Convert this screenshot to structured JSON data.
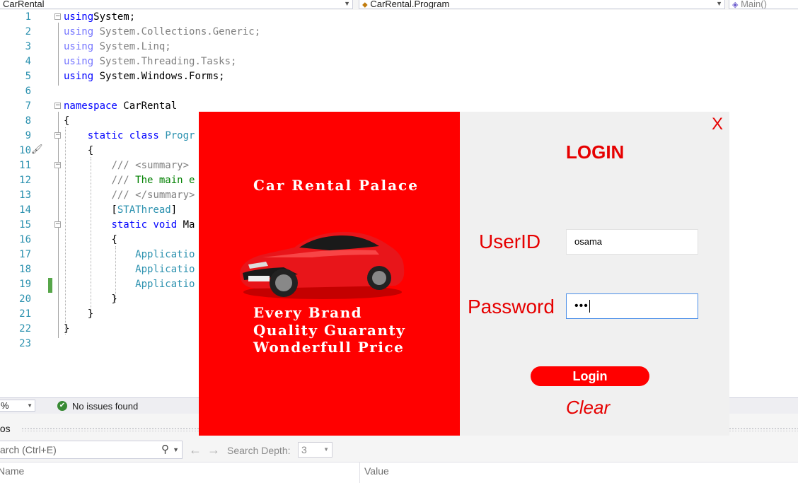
{
  "navbar": {
    "project": "CarRental",
    "class_scope": "CarRental.Program",
    "member": "Main()"
  },
  "editor": {
    "lines": [
      {
        "num": "1",
        "parts": [
          [
            "kw",
            "using"
          ],
          [
            "",
            "System;"
          ]
        ]
      },
      {
        "num": "2",
        "parts": [
          [
            "kw dim",
            "using"
          ],
          [
            "gr",
            " System.Collections.Generic;"
          ]
        ]
      },
      {
        "num": "3",
        "parts": [
          [
            "kw dim",
            "using"
          ],
          [
            "gr",
            " System.Linq;"
          ]
        ]
      },
      {
        "num": "4",
        "parts": [
          [
            "kw dim",
            "using"
          ],
          [
            "gr",
            " System.Threading.Tasks;"
          ]
        ]
      },
      {
        "num": "5",
        "parts": [
          [
            "kw",
            "using"
          ],
          [
            "",
            " System.Windows.Forms;"
          ]
        ]
      },
      {
        "num": "6",
        "parts": []
      },
      {
        "num": "7",
        "parts": [
          [
            "kw",
            "namespace"
          ],
          [
            "",
            " CarRental"
          ]
        ]
      },
      {
        "num": "8",
        "parts": [
          [
            "",
            "{"
          ]
        ]
      },
      {
        "num": "9",
        "parts": [
          [
            "",
            "    "
          ],
          [
            "kw",
            "static class"
          ],
          [
            "",
            " "
          ],
          [
            "ty",
            "Progr"
          ]
        ]
      },
      {
        "num": "10",
        "parts": [
          [
            "",
            "    {"
          ]
        ]
      },
      {
        "num": "11",
        "parts": [
          [
            "",
            "        "
          ],
          [
            "gr",
            "/// <summary>"
          ]
        ]
      },
      {
        "num": "12",
        "parts": [
          [
            "",
            "        "
          ],
          [
            "gr",
            "///"
          ],
          [
            "cm",
            " The main e"
          ]
        ]
      },
      {
        "num": "13",
        "parts": [
          [
            "",
            "        "
          ],
          [
            "gr",
            "/// </summary>"
          ]
        ]
      },
      {
        "num": "14",
        "parts": [
          [
            "",
            "        ["
          ],
          [
            "ty",
            "STAThread"
          ],
          [
            "",
            "]"
          ]
        ]
      },
      {
        "num": "15",
        "parts": [
          [
            "",
            "        "
          ],
          [
            "kw",
            "static void"
          ],
          [
            "",
            " Ma"
          ]
        ]
      },
      {
        "num": "16",
        "parts": [
          [
            "",
            "        {"
          ]
        ]
      },
      {
        "num": "17",
        "parts": [
          [
            "",
            "            "
          ],
          [
            "ty",
            "Applicatio"
          ]
        ]
      },
      {
        "num": "18",
        "parts": [
          [
            "",
            "            "
          ],
          [
            "ty",
            "Applicatio"
          ]
        ]
      },
      {
        "num": "19",
        "parts": [
          [
            "",
            "            "
          ],
          [
            "ty",
            "Applicatio"
          ]
        ]
      },
      {
        "num": "20",
        "parts": [
          [
            "",
            "        }"
          ]
        ]
      },
      {
        "num": "21",
        "parts": [
          [
            "",
            "    }"
          ]
        ]
      },
      {
        "num": "22",
        "parts": [
          [
            "",
            "}"
          ]
        ]
      },
      {
        "num": "23",
        "parts": []
      }
    ]
  },
  "statusbar": {
    "zoom": "%",
    "issues": "No issues found",
    "ok_color": "#388a34"
  },
  "autos": {
    "title": "tos",
    "search_placeholder": "arch (Ctrl+E)",
    "search_depth_label": "Search Depth:",
    "search_depth_value": "3",
    "col_name": "Name",
    "col_value": "Value"
  },
  "login_form": {
    "brand": "Car Rental Palace",
    "taglines": [
      "Every Brand",
      "Quality Guaranty",
      "Wonderfull Price"
    ],
    "close": "X",
    "title": "LOGIN",
    "userid_label": "UserID",
    "userid_value": "osama",
    "password_label": "Password",
    "password_value": "•••",
    "login_button": "Login",
    "clear_link": "Clear",
    "accent_color": "#ff0000"
  },
  "icons": [
    "class-icon",
    "method-icon",
    "check-circle-icon",
    "search-icon",
    "back-arrow-icon",
    "forward-arrow-icon",
    "car-image",
    "brush-icon"
  ]
}
